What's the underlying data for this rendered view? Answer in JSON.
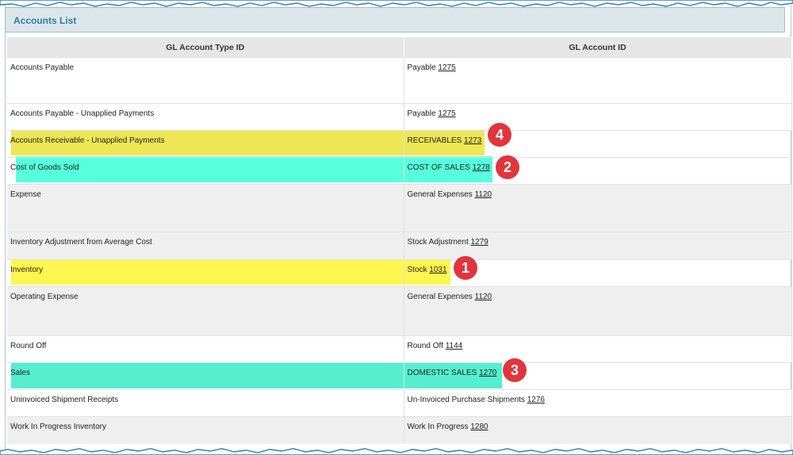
{
  "panel": {
    "title": "Accounts List"
  },
  "table": {
    "headers": [
      "GL Account Type ID",
      "GL Account ID"
    ],
    "rows": [
      {
        "type": "Accounts Payable",
        "account_name": "Payable",
        "account_id": "1275"
      },
      {
        "type": "Accounts Payable - Unapplied Payments",
        "account_name": "Payable",
        "account_id": "1275"
      },
      {
        "type": "Accounts Receivable - Unapplied Payments",
        "account_name": "RECEIVABLES",
        "account_id": "1273"
      },
      {
        "type": "Cost of Goods Sold",
        "account_name": "COST OF SALES",
        "account_id": "1278"
      },
      {
        "type": "Expense",
        "account_name": "General Expenses",
        "account_id": "1120"
      },
      {
        "type": "Inventory Adjustment from Average Cost",
        "account_name": "Stock Adjustment",
        "account_id": "1279"
      },
      {
        "type": "Inventory",
        "account_name": "Stock",
        "account_id": "1031"
      },
      {
        "type": "Operating Expense",
        "account_name": "General Expenses",
        "account_id": "1120"
      },
      {
        "type": "Round Off",
        "account_name": "Round Off",
        "account_id": "1144"
      },
      {
        "type": "Sales",
        "account_name": "DOMESTIC SALES",
        "account_id": "1270"
      },
      {
        "type": "Uninvoiced Shipment Receipts",
        "account_name": "Un-Invoiced Purchase Shipments",
        "account_id": "1276"
      },
      {
        "type": "Work In Progress Inventory",
        "account_name": "Work In Progress",
        "account_id": "1280"
      }
    ]
  },
  "annotations": {
    "badge_1": "1",
    "badge_2": "2",
    "badge_3": "3",
    "badge_4": "4"
  },
  "colors": {
    "highlight_yellow": "#fff64f",
    "highlight_olive": "#ede655",
    "highlight_aqua": "#58ffdd",
    "highlight_teal": "#55efd0",
    "badge_red": "#e0353c",
    "title_blue": "#2c7fa8"
  }
}
